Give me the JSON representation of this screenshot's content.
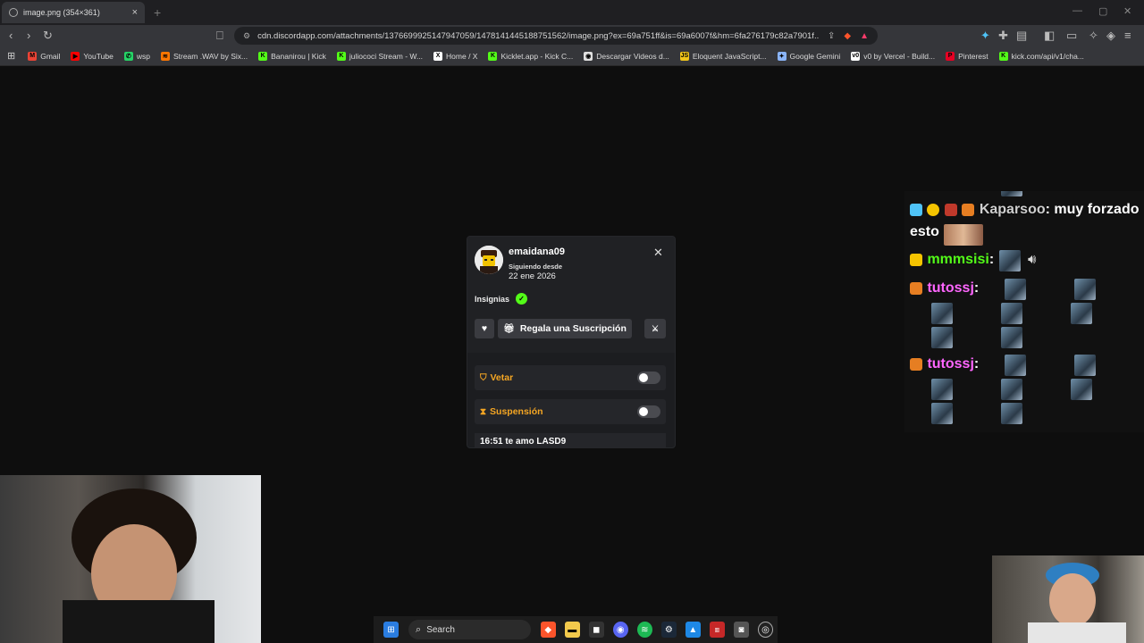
{
  "browser": {
    "tab_title": "image.png (354×361)",
    "url": "cdn.discordapp.com/attachments/1376699925147947059/1478141445188751562/image.png?ex=69a751ff&is=69a6007f&hm=6fa276179c82a7901f...",
    "bookmarks": [
      {
        "label": "Gmail",
        "color": "#ea4335",
        "icon": "M"
      },
      {
        "label": "YouTube",
        "color": "#ff0000",
        "icon": "▶"
      },
      {
        "label": "wsp",
        "color": "#25d366",
        "icon": "✆"
      },
      {
        "label": "Stream .WAV by Six...",
        "color": "#ff7700",
        "icon": "≋"
      },
      {
        "label": "Bananirou | Kick",
        "color": "#53fc18",
        "icon": "K"
      },
      {
        "label": "juliococi Stream - W...",
        "color": "#53fc18",
        "icon": "K"
      },
      {
        "label": "Home / X",
        "color": "#ffffff",
        "icon": "X"
      },
      {
        "label": "Kicklet.app - Kick C...",
        "color": "#53fc18",
        "icon": "K"
      },
      {
        "label": "Descargar Videos d...",
        "color": "#e0e0e0",
        "icon": "◉"
      },
      {
        "label": "Eloquent JavaScript...",
        "color": "#f0c419",
        "icon": "JS"
      },
      {
        "label": "Google Gemini",
        "color": "#8ab4f8",
        "icon": "✦"
      },
      {
        "label": "v0 by Vercel - Build...",
        "color": "#ffffff",
        "icon": "v0"
      },
      {
        "label": "Pinterest",
        "color": "#e60023",
        "icon": "P"
      },
      {
        "label": "kick.com/api/v1/cha...",
        "color": "#53fc18",
        "icon": "K"
      }
    ]
  },
  "popup": {
    "username": "emaidana09",
    "following_label": "Siguiendo desde",
    "following_date": "22 ene 2026",
    "badges_label": "Insignias",
    "gift_button": "Regala una Suscripción",
    "rows": [
      {
        "label": "Vetar",
        "icon": "shield-icon"
      },
      {
        "label": "Suspensión",
        "icon": "hourglass-icon"
      }
    ],
    "message": "16:51 te amo LASD9"
  },
  "chat": {
    "lines": [
      {
        "user": "Kaparsoo",
        "text": ": muy forzado"
      },
      {
        "user": "",
        "text": "esto"
      },
      {
        "user": "mmmsisi",
        "text": ":"
      },
      {
        "user": "tutossj",
        "text": ":"
      },
      {
        "user": "tutossj",
        "text": ":"
      }
    ]
  },
  "taskbar": {
    "search_label": "Search"
  }
}
